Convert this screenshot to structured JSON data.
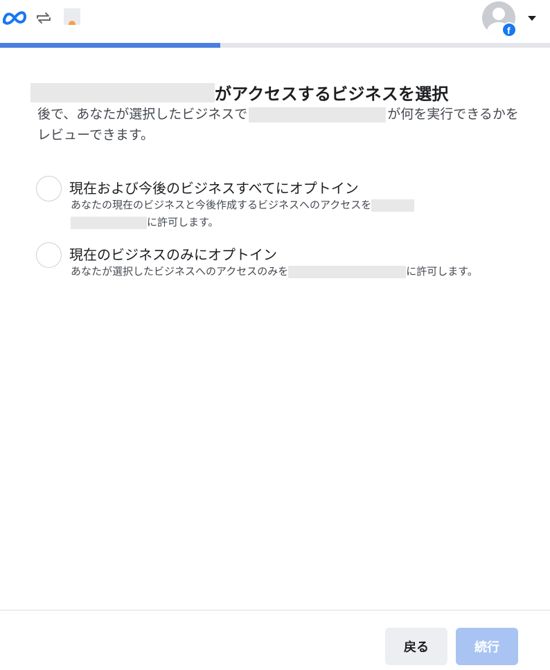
{
  "header": {
    "logo_icon": "meta-logo-icon",
    "switch_icon": "switch-arrows-icon",
    "account_icon": "profile-avatar-icon",
    "account_badge_icon": "facebook-icon",
    "menu_icon": "caret-down-icon"
  },
  "progress": {
    "fraction": 0.4
  },
  "title": {
    "suffix": "がアクセスするビジネスを選択"
  },
  "description": {
    "part1": "後で、あなたが選択したビジネスで",
    "part2": "が何を実行できるかをレビューできます。"
  },
  "options": [
    {
      "title": "現在および今後のビジネスすべてにオプトイン",
      "desc_part1": "あなたの現在のビジネスと今後作成するビジネスへのアクセスを",
      "desc_part2": "に許可します。",
      "selected": false
    },
    {
      "title": "現在のビジネスのみにオプトイン",
      "desc_part1": "あなたが選択したビジネスへのアクセスのみを",
      "desc_part2": "に許可します。",
      "selected": false
    }
  ],
  "footer": {
    "back_label": "戻る",
    "continue_label": "続行"
  },
  "colors": {
    "accent": "#4a7fe0",
    "continue_disabled": "#a9c4f3",
    "facebook_blue": "#1877f2"
  }
}
